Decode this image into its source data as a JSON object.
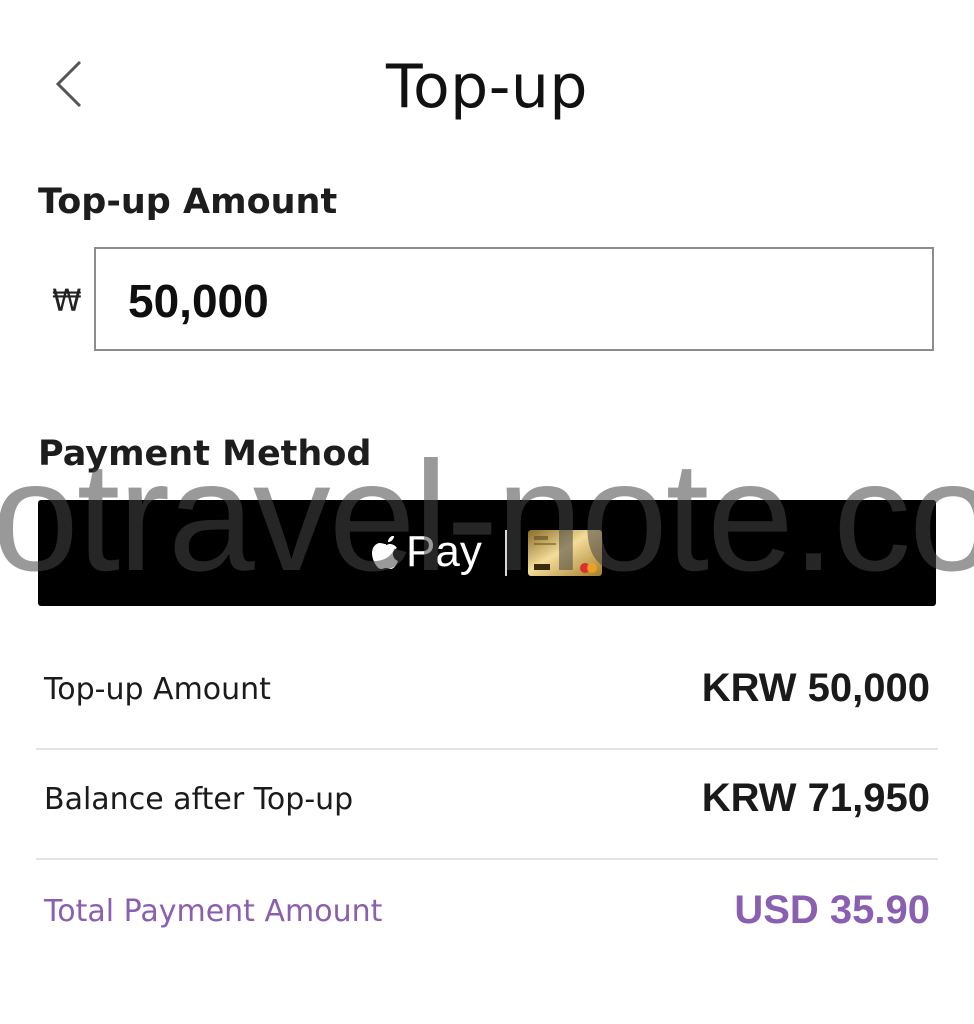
{
  "header": {
    "title": "Top-up",
    "back_icon": "chevron-left-icon"
  },
  "amount_section": {
    "label": "Top-up Amount",
    "currency_symbol": "₩",
    "value": "50,000"
  },
  "payment_section": {
    "label": "Payment Method",
    "button": {
      "text": "Pay",
      "brand_icon": "apple-logo-icon",
      "card_icon": "gold-card-icon",
      "background": "#000000"
    }
  },
  "watermark": "otravel-note.co",
  "summary": {
    "rows": [
      {
        "label": "Top-up Amount",
        "value": "KRW 50,000"
      },
      {
        "label": "Balance after Top-up",
        "value": "KRW 71,950"
      },
      {
        "label": "Total Payment Amount",
        "value": "USD 35.90"
      }
    ],
    "accent_color": "#8a5fb1"
  }
}
